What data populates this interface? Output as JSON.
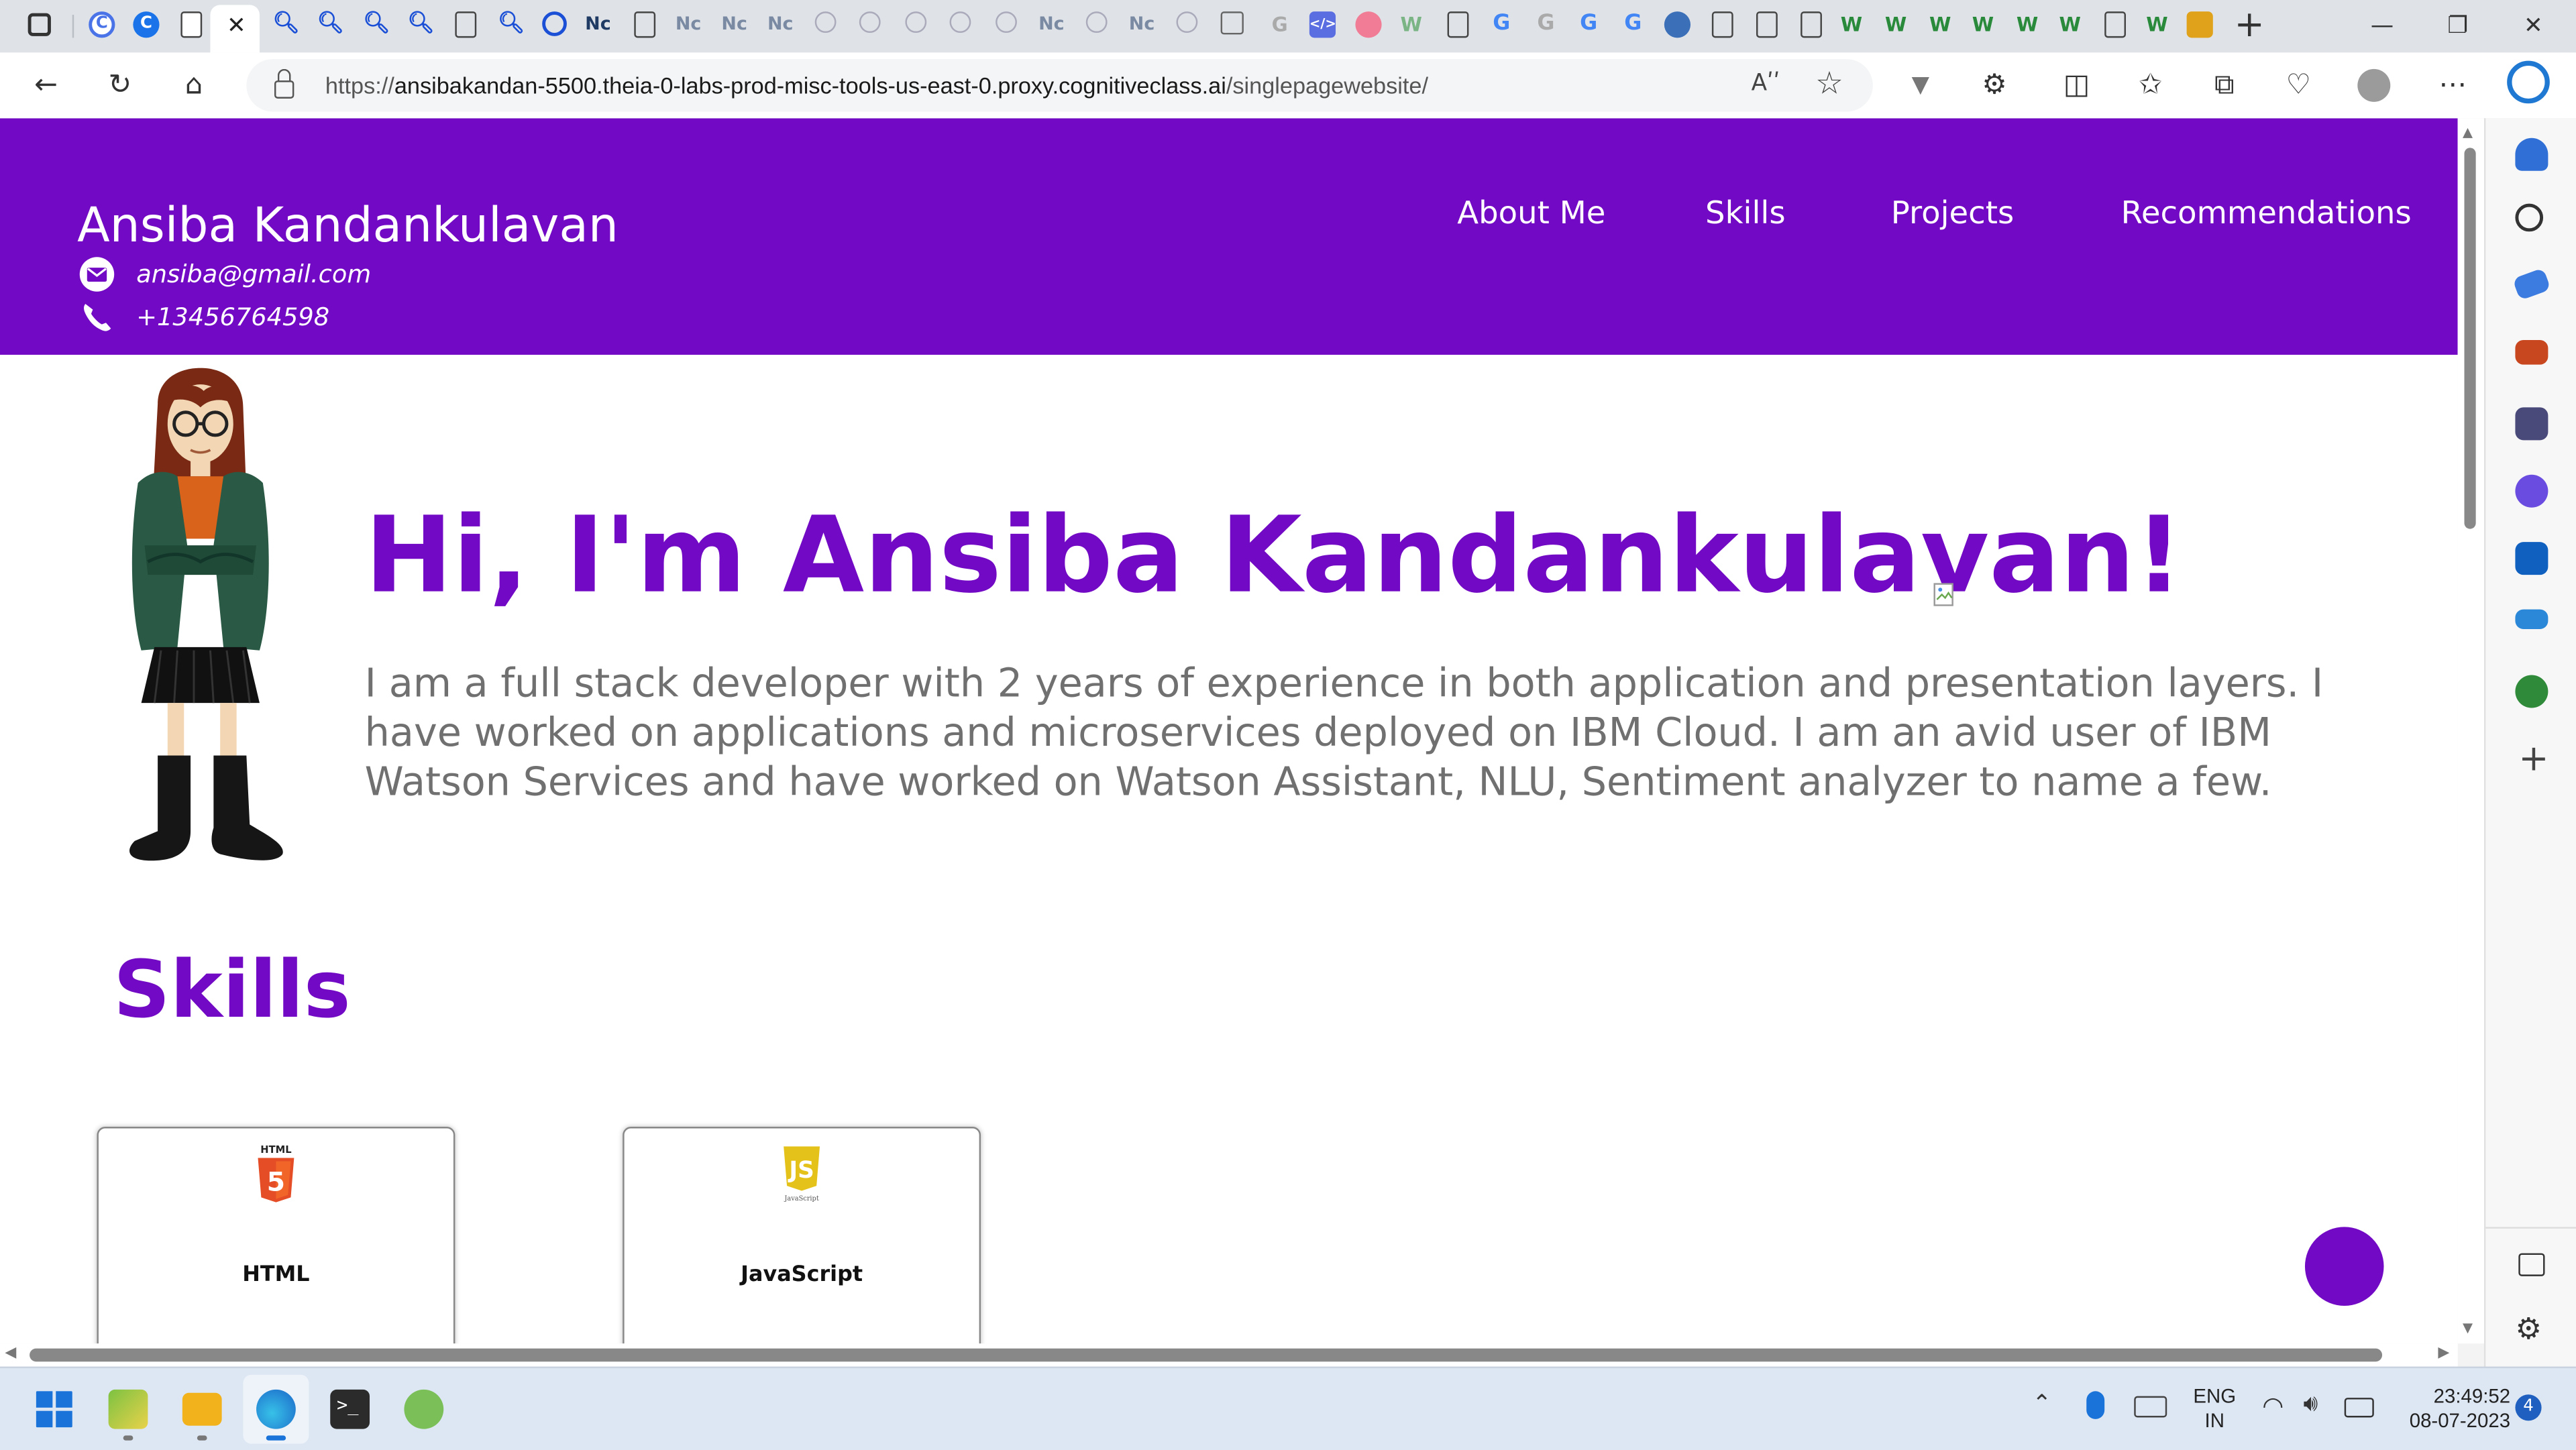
{
  "browser": {
    "url_prefix": "https://",
    "url_host": "ansibakandan-5500.theia-0-labs-prod-misc-tools-us-east-0.proxy.cognitiveclass.ai",
    "url_path": "/singlepagewebsite/",
    "read_aloud_label": "Aʹʹ",
    "window_controls": {
      "minimize": "—",
      "maximize": "❐",
      "close": "✕"
    },
    "tab_close": "✕",
    "new_tab": "+"
  },
  "site": {
    "name": "Ansiba Kandankulavan",
    "email": "ansiba@gmail.com",
    "phone": "+13456764598",
    "nav": [
      "About Me",
      "Skills",
      "Projects",
      "Recommendations"
    ],
    "hero_title": "Hi, I'm Ansiba Kandankulavan!",
    "hero_text": "I am a full stack developer with 2 years of experience in both application and presentation layers. I have worked on applications and microservices deployed on IBM Cloud. I am an avid user of IBM Watson Services and have worked on Watson Assistant, NLU, Sentiment analyzer to name a few.",
    "skills_title": "Skills",
    "skills": [
      {
        "name": "HTML",
        "badge": "HTML",
        "icon": "html5-logo-icon"
      },
      {
        "name": "JavaScript",
        "badge": "JS",
        "sub": "JavaScript",
        "icon": "js-logo-icon"
      }
    ]
  },
  "taskbar": {
    "lang_top": "ENG",
    "lang_bottom": "IN",
    "time": "23:49:52",
    "date": "08-07-2023",
    "notification_count": "4"
  },
  "colors": {
    "brand": "#7209c4",
    "body_text": "#707070"
  }
}
